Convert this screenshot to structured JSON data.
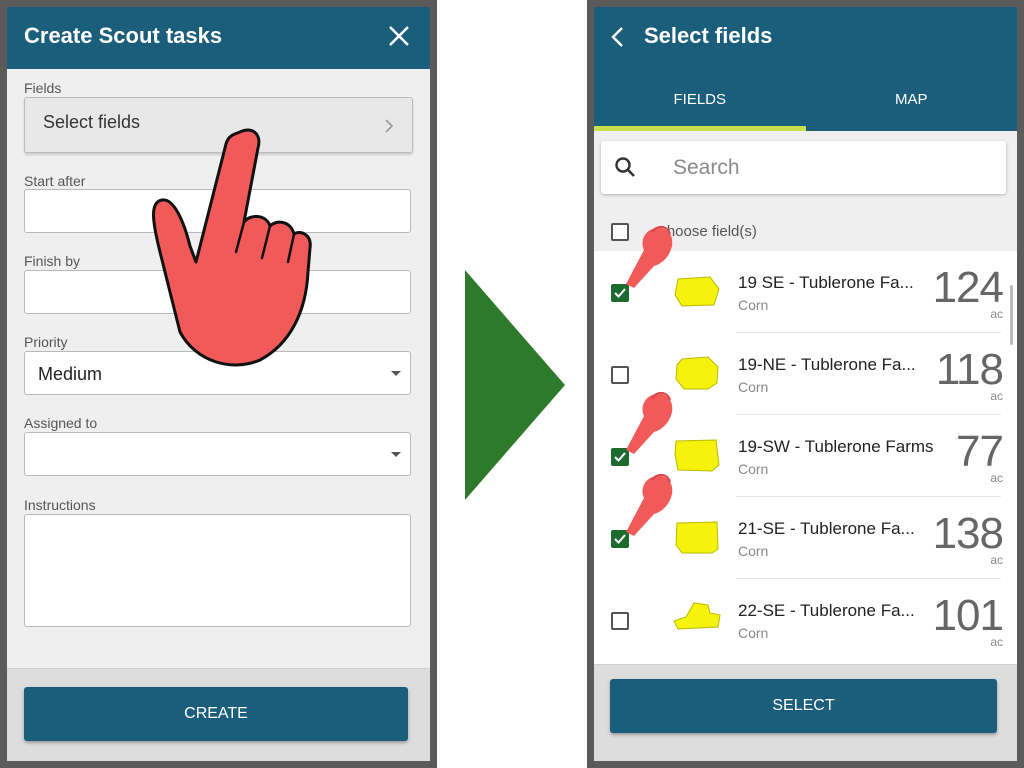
{
  "left_screen": {
    "title": "Create Scout tasks",
    "fields_label": "Fields",
    "select_fields_text": "Select fields",
    "start_after_label": "Start after",
    "finish_by_label": "Finish by",
    "priority_label": "Priority",
    "priority_value": "Medium",
    "assigned_to_label": "Assigned to",
    "instructions_label": "Instructions",
    "create_button": "CREATE"
  },
  "right_screen": {
    "title": "Select fields",
    "tabs": [
      {
        "label": "FIELDS",
        "active": true
      },
      {
        "label": "MAP",
        "active": false
      }
    ],
    "search_placeholder": "Search",
    "choose_label": "Choose field(s)",
    "fields": [
      {
        "name": "19 SE - Tublerone Fa...",
        "crop": "Corn",
        "acres": "124",
        "unit": "ac",
        "checked": true
      },
      {
        "name": "19-NE - Tublerone Fa...",
        "crop": "Corn",
        "acres": "118",
        "unit": "ac",
        "checked": false
      },
      {
        "name": "19-SW - Tublerone Farms",
        "crop": "Corn",
        "acres": "77",
        "unit": "ac",
        "checked": true
      },
      {
        "name": "21-SE - Tublerone Fa...",
        "crop": "Corn",
        "acres": "138",
        "unit": "ac",
        "checked": true
      },
      {
        "name": "22-SE - Tublerone Fa...",
        "crop": "Corn",
        "acres": "101",
        "unit": "ac",
        "checked": false
      }
    ],
    "select_button": "SELECT"
  },
  "colors": {
    "header": "#1a5e7c",
    "tab_indicator": "#c8e04a",
    "checkbox_checked": "#1e6b2f",
    "field_shape": "#f5f20c",
    "arrow": "#2d7a2d",
    "hand": "#f25a5a"
  },
  "icons": [
    "close-icon",
    "chevron-right-icon",
    "back-arrow-icon",
    "search-icon",
    "dropdown-arrow-icon",
    "checkmark-icon",
    "pointing-hand-icon"
  ]
}
